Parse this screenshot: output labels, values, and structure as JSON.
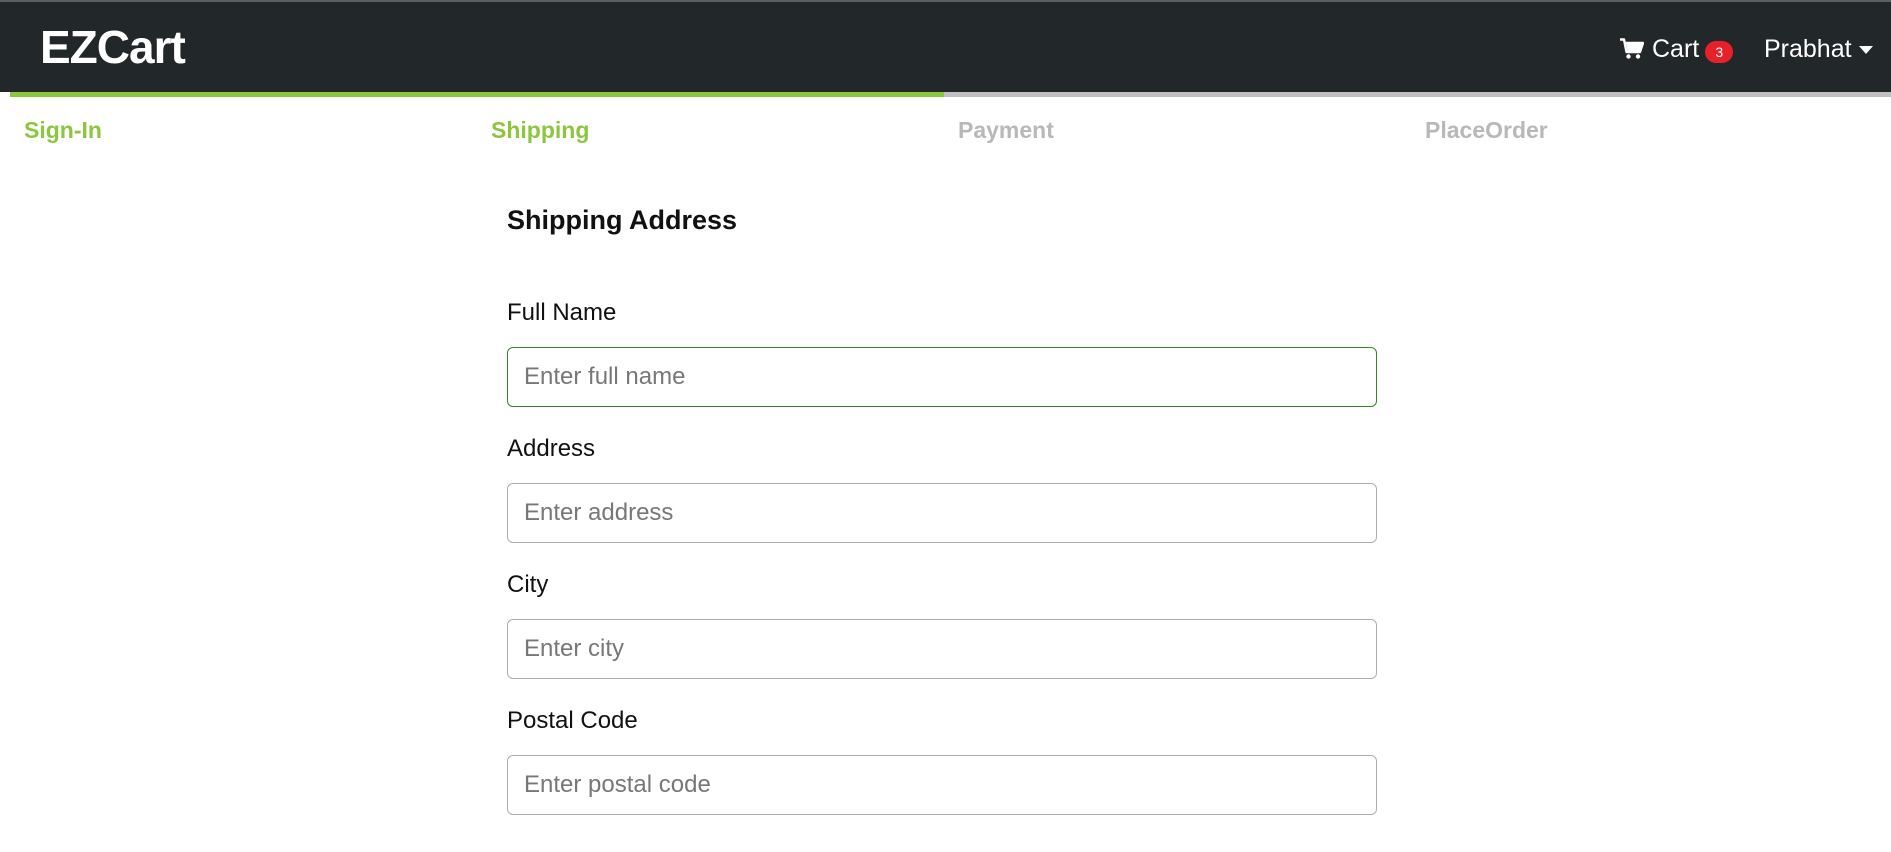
{
  "navbar": {
    "brand": "EZCart",
    "cart_label": "Cart",
    "cart_count": "3",
    "user_name": "Prabhat"
  },
  "steps": [
    {
      "label": "Sign-In",
      "active": true
    },
    {
      "label": "Shipping",
      "active": true
    },
    {
      "label": "Payment",
      "active": false
    },
    {
      "label": "PlaceOrder",
      "active": false
    }
  ],
  "form": {
    "title": "Shipping Address",
    "fields": [
      {
        "label": "Full Name",
        "placeholder": "Enter full name",
        "value": ""
      },
      {
        "label": "Address",
        "placeholder": "Enter address",
        "value": ""
      },
      {
        "label": "City",
        "placeholder": "Enter city",
        "value": ""
      },
      {
        "label": "Postal Code",
        "placeholder": "Enter postal code",
        "value": ""
      }
    ]
  },
  "colors": {
    "navbar_bg": "#222829",
    "accent_green": "#8cc63f",
    "badge_red": "#e8202a",
    "focus_border": "#2e8b1f",
    "inactive_step": "#b8b8b8"
  },
  "icons": {
    "cart": "shopping-cart-icon",
    "user_dropdown": "caret-down-icon"
  }
}
